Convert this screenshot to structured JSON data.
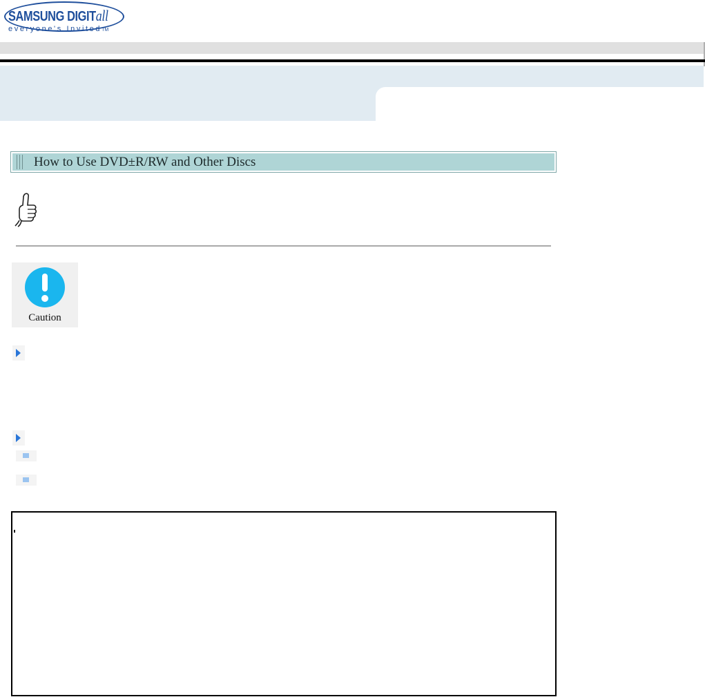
{
  "logo": {
    "brand": "SAMSUNG DIGIT",
    "brand_suffix": "all",
    "tagline": "everyone's Invited",
    "tm": "TM"
  },
  "section": {
    "title": "How to Use  DVD±R/RW and Other Discs"
  },
  "caution": {
    "label": "Caution"
  },
  "colors": {
    "title_bar": "#afd5d6",
    "caution_icon": "#1ab6ee",
    "bullet_arrow": "#2a76d8",
    "header_band": "#e1ebf2"
  }
}
